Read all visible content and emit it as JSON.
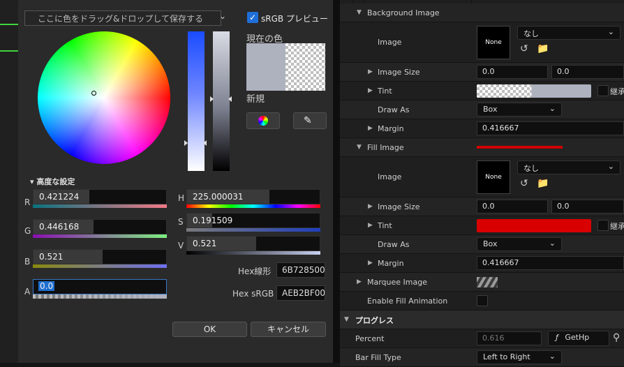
{
  "dialog": {
    "drop_hint": "ここに色をドラッグ&ドロップして保存する",
    "srgb_preview": "sRGB プレビュー",
    "srgb_checked": true,
    "current_color_label": "現在の色",
    "new_label": "新規",
    "advanced_label": "高度な設定",
    "current_color": "#aeb2bf",
    "channels": {
      "r": {
        "letter": "R",
        "value": "0.421224",
        "fill": 0.42
      },
      "g": {
        "letter": "G",
        "value": "0.446168",
        "fill": 0.45
      },
      "b": {
        "letter": "B",
        "value": "0.521",
        "fill": 0.52
      },
      "a": {
        "letter": "A",
        "value": "0.0",
        "fill": 0.0
      },
      "h": {
        "letter": "H",
        "value": "225.000031",
        "fill": 0.62
      },
      "s": {
        "letter": "S",
        "value": "0.191509",
        "fill": 0.19
      },
      "v": {
        "letter": "V",
        "value": "0.521",
        "fill": 0.52
      }
    },
    "hex_linear_label": "Hex線形",
    "hex_linear_value": "6B728500",
    "hex_srgb_label": "Hex sRGB",
    "hex_srgb_value": "AEB2BF00",
    "ok_label": "OK",
    "cancel_label": "キャンセル"
  },
  "details": {
    "background_image": {
      "header": "Background Image",
      "image_label": "Image",
      "thumb_label": "None",
      "image_combo": "なし",
      "image_size_label": "Image Size",
      "image_size_x": "0.0",
      "image_size_y": "0.0",
      "tint_label": "Tint",
      "tint_color": "#aeb2bf",
      "tint_check_label": "継承",
      "draw_as_label": "Draw As",
      "draw_as_value": "Box",
      "margin_label": "Margin",
      "margin_value": "0.416667"
    },
    "fill_image": {
      "header": "Fill Image",
      "swatch_color": "#d00000",
      "image_label": "Image",
      "thumb_label": "None",
      "image_combo": "なし",
      "image_size_label": "Image Size",
      "image_size_x": "0.0",
      "image_size_y": "0.0",
      "tint_label": "Tint",
      "tint_color": "#d80000",
      "tint_check_label": "継承",
      "draw_as_label": "Draw As",
      "draw_as_value": "Box",
      "margin_label": "Margin",
      "margin_value": "0.416667"
    },
    "marquee_image_label": "Marquee Image",
    "enable_fill_animation_label": "Enable Fill Animation",
    "progress_section": "プログレス",
    "percent_label": "Percent",
    "percent_value": "0.616",
    "percent_binding": "GetHp",
    "bar_fill_type_label": "Bar Fill Type",
    "bar_fill_type_value": "Left to Right"
  }
}
